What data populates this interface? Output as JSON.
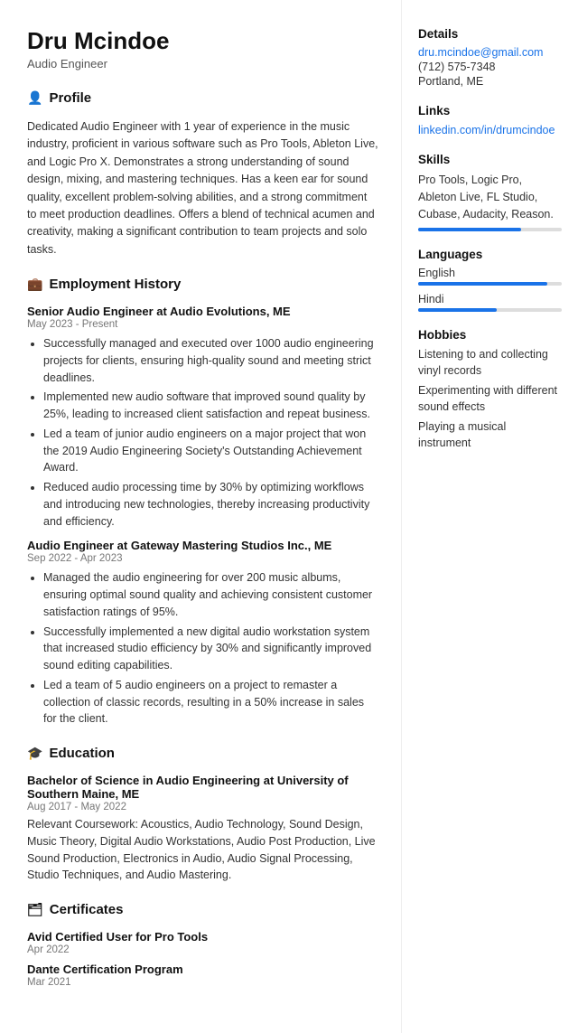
{
  "header": {
    "name": "Dru Mcindoe",
    "title": "Audio Engineer"
  },
  "sections": {
    "profile": {
      "icon": "👤",
      "label": "Profile",
      "text": "Dedicated Audio Engineer with 1 year of experience in the music industry, proficient in various software such as Pro Tools, Ableton Live, and Logic Pro X. Demonstrates a strong understanding of sound design, mixing, and mastering techniques. Has a keen ear for sound quality, excellent problem-solving abilities, and a strong commitment to meet production deadlines. Offers a blend of technical acumen and creativity, making a significant contribution to team projects and solo tasks."
    },
    "employment": {
      "icon": "💼",
      "label": "Employment History",
      "jobs": [
        {
          "title": "Senior Audio Engineer at Audio Evolutions, ME",
          "date": "May 2023 - Present",
          "bullets": [
            "Successfully managed and executed over 1000 audio engineering projects for clients, ensuring high-quality sound and meeting strict deadlines.",
            "Implemented new audio software that improved sound quality by 25%, leading to increased client satisfaction and repeat business.",
            "Led a team of junior audio engineers on a major project that won the 2019 Audio Engineering Society's Outstanding Achievement Award.",
            "Reduced audio processing time by 30% by optimizing workflows and introducing new technologies, thereby increasing productivity and efficiency."
          ]
        },
        {
          "title": "Audio Engineer at Gateway Mastering Studios Inc., ME",
          "date": "Sep 2022 - Apr 2023",
          "bullets": [
            "Managed the audio engineering for over 200 music albums, ensuring optimal sound quality and achieving consistent customer satisfaction ratings of 95%.",
            "Successfully implemented a new digital audio workstation system that increased studio efficiency by 30% and significantly improved sound editing capabilities.",
            "Led a team of 5 audio engineers on a project to remaster a collection of classic records, resulting in a 50% increase in sales for the client."
          ]
        }
      ]
    },
    "education": {
      "icon": "🎓",
      "label": "Education",
      "items": [
        {
          "degree": "Bachelor of Science in Audio Engineering at University of Southern Maine, ME",
          "date": "Aug 2017 - May 2022",
          "coursework": "Relevant Coursework: Acoustics, Audio Technology, Sound Design, Music Theory, Digital Audio Workstations, Audio Post Production, Live Sound Production, Electronics in Audio, Audio Signal Processing, Studio Techniques, and Audio Mastering."
        }
      ]
    },
    "certificates": {
      "icon": "🗂",
      "label": "Certificates",
      "items": [
        {
          "title": "Avid Certified User for Pro Tools",
          "date": "Apr 2022"
        },
        {
          "title": "Dante Certification Program",
          "date": "Mar 2021"
        }
      ]
    }
  },
  "sidebar": {
    "details": {
      "label": "Details",
      "email": "dru.mcindoe@gmail.com",
      "phone": "(712) 575-7348",
      "location": "Portland, ME"
    },
    "links": {
      "label": "Links",
      "linkedin": "linkedin.com/in/drumcindoe"
    },
    "skills": {
      "label": "Skills",
      "text": "Pro Tools, Logic Pro, Ableton Live, FL Studio, Cubase, Audacity, Reason.",
      "bar_width": "72%"
    },
    "languages": {
      "label": "Languages",
      "items": [
        {
          "name": "English",
          "level": 90
        },
        {
          "name": "Hindi",
          "level": 55
        }
      ]
    },
    "hobbies": {
      "label": "Hobbies",
      "items": [
        "Listening to and collecting vinyl records",
        "Experimenting with different sound effects",
        "Playing a musical instrument"
      ]
    }
  }
}
